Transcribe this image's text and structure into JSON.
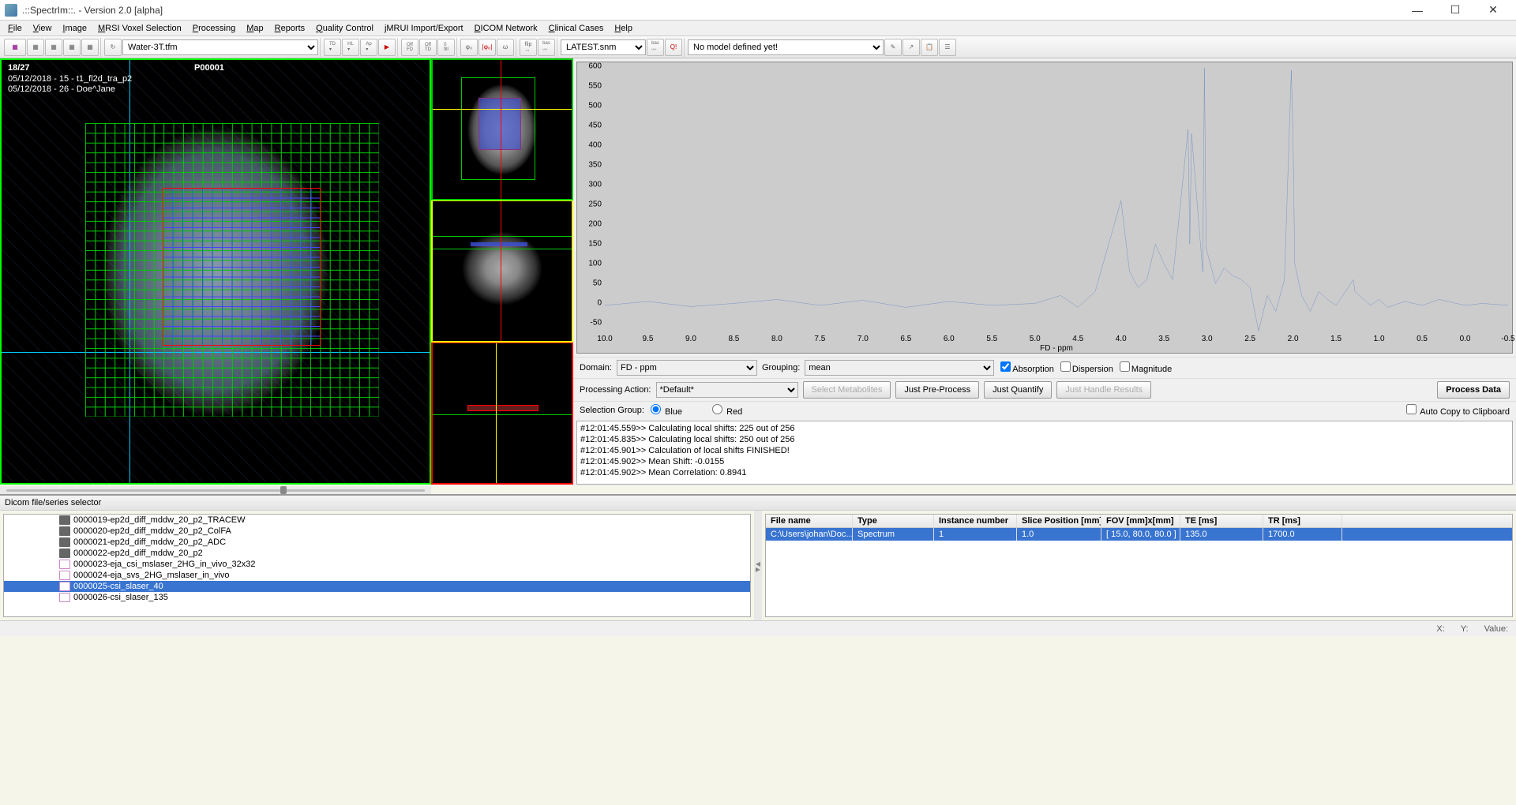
{
  "window": {
    "title": ".::SpectrIm::.   -   Version 2.0 [alpha]"
  },
  "menus": [
    "File",
    "View",
    "Image",
    "MRSI Voxel Selection",
    "Processing",
    "Map",
    "Reports",
    "Quality Control",
    "jMRUI Import/Export",
    "DICOM Network",
    "Clinical Cases",
    "Help"
  ],
  "toolbar": {
    "tfm_select": "Water-3T.tfm",
    "snm_select": "LATEST.snm",
    "model_select": "No model defined yet!"
  },
  "viewer": {
    "slice_counter": "18/27",
    "patient_id": "P00001",
    "line1": "05/12/2018 - 15 - t1_fl2d_tra_p2",
    "line2": "05/12/2018 - 26 - Doe^Jane"
  },
  "domain": {
    "label": "Domain:",
    "value": "FD - ppm",
    "grouping_label": "Grouping:",
    "grouping_value": "mean",
    "absorption": "Absorption",
    "dispersion": "Dispersion",
    "magnitude": "Magnitude"
  },
  "processing": {
    "label": "Processing Action:",
    "value": "*Default*",
    "select_metab": "Select Metabolites",
    "pre_process": "Just Pre-Process",
    "quantify": "Just Quantify",
    "handle_results": "Just Handle Results",
    "process_data": "Process Data"
  },
  "selection": {
    "label": "Selection Group:",
    "blue": "Blue",
    "red": "Red",
    "auto_copy": "Auto Copy to Clipboard"
  },
  "log": [
    "#12:01:45.559>> Calculating local shifts: 225 out of 256",
    "#12:01:45.835>> Calculating local shifts: 250 out of 256",
    "#12:01:45.901>> Calculation of local shifts FINISHED!",
    "#12:01:45.902>> Mean Shift: -0.0155",
    "#12:01:45.902>> Mean Correlation: 0.8941"
  ],
  "selector": {
    "header": "Dicom file/series selector"
  },
  "series": [
    {
      "name": "0000019-ep2d_diff_mddw_20_p2_TRACEW",
      "sel": false,
      "t": "g"
    },
    {
      "name": "0000020-ep2d_diff_mddw_20_p2_ColFA",
      "sel": false,
      "t": "g"
    },
    {
      "name": "0000021-ep2d_diff_mddw_20_p2_ADC",
      "sel": false,
      "t": "g"
    },
    {
      "name": "0000022-ep2d_diff_mddw_20_p2",
      "sel": false,
      "t": "g"
    },
    {
      "name": "0000023-eja_csi_mslaser_2HG_in_vivo_32x32",
      "sel": false,
      "t": "p"
    },
    {
      "name": "0000024-eja_svs_2HG_mslaser_in_vivo",
      "sel": false,
      "t": "p"
    },
    {
      "name": "0000025-csi_slaser_40",
      "sel": true,
      "t": "p"
    },
    {
      "name": "0000026-csi_slaser_135",
      "sel": false,
      "t": "p"
    }
  ],
  "file_table": {
    "headers": [
      "File name",
      "Type",
      "Instance number",
      "Slice Position [mm]",
      "FOV [mm]x[mm]",
      "TE [ms]",
      "TR [ms]"
    ],
    "rows": [
      {
        "cells": [
          "C:\\Users\\johan\\Doc...",
          "Spectrum",
          "1",
          "1.0",
          "[ 15.0, 80.0, 80.0 ]",
          "135.0",
          "1700.0"
        ],
        "sel": true
      }
    ]
  },
  "status": {
    "x": "X:",
    "y": "Y:",
    "value": "Value:"
  },
  "chart_data": {
    "type": "line",
    "title": "",
    "xlabel": "FD - ppm",
    "ylabel": "",
    "ylim": [
      -75,
      600
    ],
    "xlim": [
      10.0,
      -0.5
    ],
    "x_ticks": [
      10.0,
      9.5,
      9.0,
      8.5,
      8.0,
      7.5,
      7.0,
      6.5,
      6.0,
      5.5,
      5.0,
      4.5,
      4.0,
      3.5,
      3.0,
      2.5,
      2.0,
      1.5,
      1.0,
      0.5,
      0.0,
      -0.5
    ],
    "y_ticks": [
      -50,
      0,
      50,
      100,
      150,
      200,
      250,
      300,
      350,
      400,
      450,
      500,
      550,
      600
    ],
    "series": [
      {
        "name": "spectrum",
        "color": "#4070c0",
        "x": [
          10.0,
          9.5,
          9.0,
          8.5,
          8.0,
          7.5,
          7.0,
          6.5,
          6.0,
          5.5,
          5.0,
          4.7,
          4.5,
          4.3,
          4.0,
          3.9,
          3.8,
          3.7,
          3.6,
          3.5,
          3.4,
          3.22,
          3.2,
          3.18,
          3.05,
          3.03,
          3.01,
          2.9,
          2.8,
          2.7,
          2.6,
          2.5,
          2.4,
          2.3,
          2.2,
          2.1,
          2.02,
          2.0,
          1.98,
          1.9,
          1.8,
          1.7,
          1.6,
          1.5,
          1.3,
          1.28,
          1.1,
          1.0,
          0.9,
          0.7,
          0.5,
          0.3,
          0.0,
          -0.2,
          -0.5
        ],
        "values": [
          -5,
          5,
          -8,
          0,
          10,
          -5,
          8,
          -10,
          5,
          -5,
          0,
          20,
          -10,
          30,
          260,
          80,
          40,
          60,
          150,
          100,
          60,
          440,
          150,
          430,
          80,
          595,
          140,
          50,
          90,
          70,
          60,
          40,
          -70,
          20,
          -20,
          60,
          590,
          420,
          100,
          20,
          -20,
          30,
          10,
          -5,
          60,
          30,
          -5,
          10,
          -10,
          5,
          -5,
          10,
          -5,
          0,
          -5
        ]
      }
    ]
  }
}
